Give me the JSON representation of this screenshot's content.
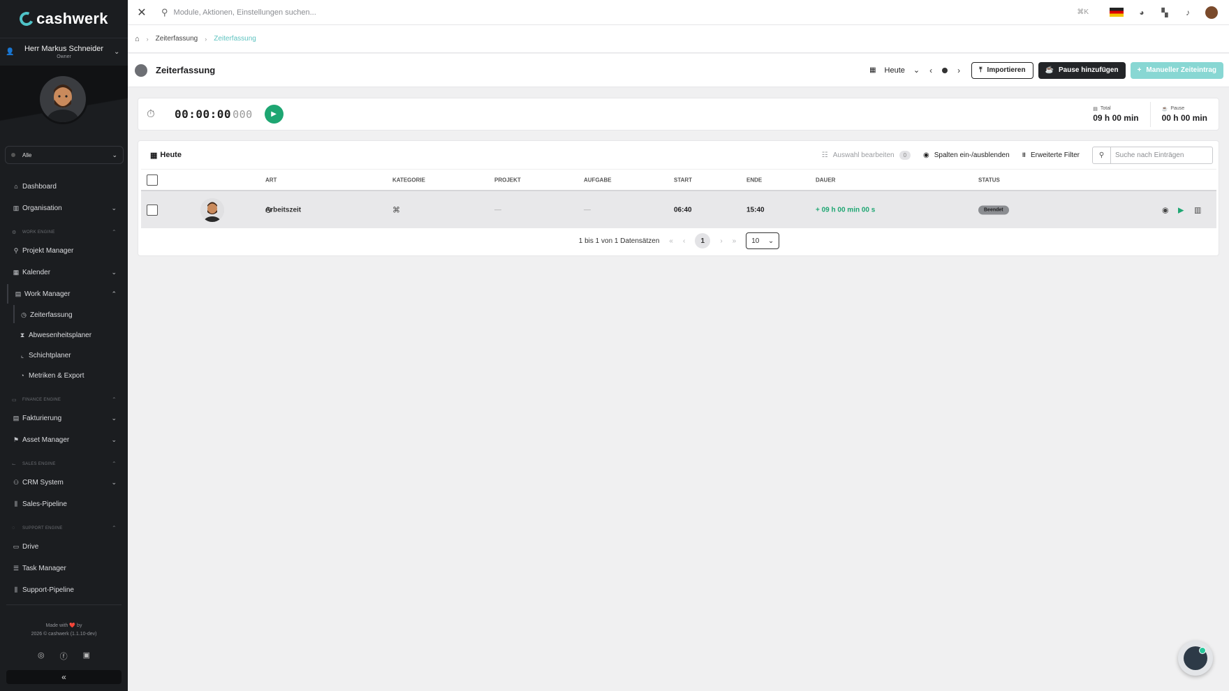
{
  "brand": {
    "logo": "cashwerk"
  },
  "user": {
    "name": "Herr Markus Schneider",
    "role": "Owner"
  },
  "workspace_filter": "Alle",
  "sidebar": {
    "dashboard": "Dashboard",
    "organisation": "Organisation",
    "section_work": "WORK ENGINE",
    "projekt_manager": "Projekt Manager",
    "kalender": "Kalender",
    "work_manager": "Work Manager",
    "zeiterfassung": "Zeiterfassung",
    "abwesenheitsplaner": "Abwesenheitsplaner",
    "schichtplaner": "Schichtplaner",
    "metriken": "Metriken & Export",
    "section_finance": "FINANCE ENGINE",
    "fakturierung": "Fakturierung",
    "asset_manager": "Asset Manager",
    "section_sales": "SALES ENGINE",
    "crm": "CRM System",
    "sales_pipeline": "Sales-Pipeline",
    "section_support": "SUPPORT ENGINE",
    "drive": "Drive",
    "task_manager": "Task Manager",
    "support_pipeline": "Support-Pipeline"
  },
  "footer": {
    "made_with": "Made with ❤️ by",
    "copyright": "2026 © cashwerk (1.1.10-dev)"
  },
  "topbar": {
    "search_placeholder": "Module, Aktionen, Einstellungen suchen...",
    "shortcut": "⌘K"
  },
  "breadcrumb": {
    "first": "Zeiterfassung",
    "current": "Zeiterfassung"
  },
  "page": {
    "title": "Zeiterfassung",
    "date_label": "Heute",
    "import_label": "Importieren",
    "pause_label": "Pause hinzufügen",
    "manual_label": "Manueller Zeiteintrag"
  },
  "timer": {
    "time": "00:00:00",
    "ms": "000",
    "total_label": "Total",
    "total_value": "09 h 00 min",
    "pause_label": "Pause",
    "pause_value": "00 h 00 min"
  },
  "table": {
    "title": "Heute",
    "edit_selection": "Auswahl bearbeiten",
    "selection_count": "0",
    "toggle_columns": "Spalten ein-/ausblenden",
    "advanced_filter": "Erweiterte Filter",
    "search_placeholder": "Suche nach Einträgen",
    "headers": {
      "art": "ART",
      "kategorie": "KATEGORIE",
      "projekt": "PROJEKT",
      "aufgabe": "AUFGABE",
      "start": "START",
      "ende": "ENDE",
      "dauer": "DAUER",
      "status": "STATUS"
    },
    "rows": [
      {
        "art": "Arbeitszeit",
        "projekt": "—",
        "aufgabe": "—",
        "start": "06:40",
        "ende": "15:40",
        "dauer": "+ 09 h 00 min 00 s",
        "status": "Beendet"
      }
    ],
    "pagination": {
      "summary": "1 bis 1 von 1 Datensätzen",
      "page": "1",
      "page_size": "10"
    }
  },
  "colors": {
    "accent_teal": "#5ec3c0",
    "success_green": "#1ea672",
    "sidebar_bg": "#1b1d20"
  }
}
